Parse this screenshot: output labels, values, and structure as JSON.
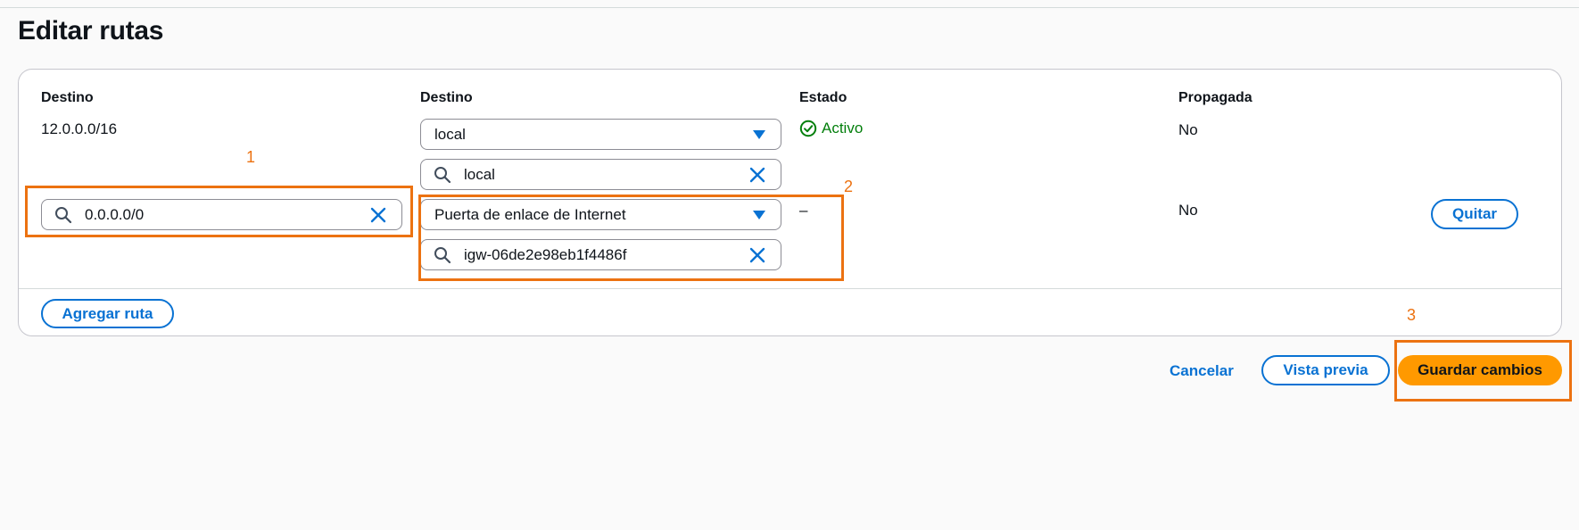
{
  "page": {
    "title": "Editar rutas"
  },
  "table": {
    "headers": {
      "destination": "Destino",
      "target": "Destino",
      "status": "Estado",
      "propagated": "Propagada"
    },
    "rows": [
      {
        "destination": "12.0.0.0/16",
        "target_select": "local",
        "target_search": "local",
        "status": "Activo",
        "propagated": "No"
      },
      {
        "destination_input": "0.0.0.0/0",
        "target_select": "Puerta de enlace de Internet",
        "target_search": "igw-06de2e98eb1f4486f",
        "status": "–",
        "propagated": "No",
        "remove_label": "Quitar"
      }
    ],
    "add_route_label": "Agregar ruta"
  },
  "footer": {
    "cancel_label": "Cancelar",
    "preview_label": "Vista previa",
    "save_label": "Guardar cambios"
  },
  "annotations": [
    "1",
    "2",
    "3"
  ],
  "colors": {
    "accent": "#0972d3",
    "success": "#037f0c",
    "primary_button": "#ff9900",
    "annotation": "#ec7211"
  }
}
